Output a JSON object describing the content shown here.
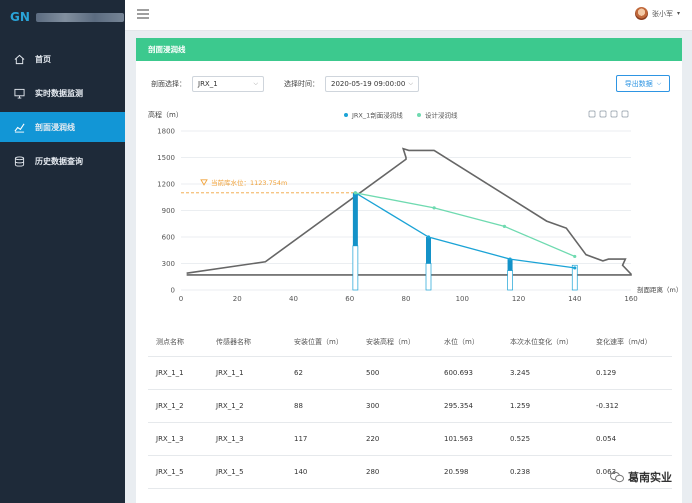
{
  "sidebar": {
    "items": [
      {
        "label": "首页",
        "icon": "home-icon"
      },
      {
        "label": "实时数据监测",
        "icon": "monitor-icon"
      },
      {
        "label": "剖面浸润线",
        "icon": "chart-line-icon",
        "active": true
      },
      {
        "label": "历史数据查询",
        "icon": "database-icon"
      }
    ]
  },
  "topbar": {
    "user_name": "张小军"
  },
  "panel": {
    "title": "剖面浸润线",
    "filters": {
      "section_label": "剖面选择：",
      "section_value": "JRX_1",
      "time_label": "选择时间：",
      "time_value": "2020-05-19 09:00:00"
    },
    "export_label": "导出数据"
  },
  "chart_data": {
    "type": "line",
    "ylabel": "高程（m）",
    "xlabel": "剖面距离（m）",
    "xlim": [
      0,
      160
    ],
    "ylim": [
      0,
      1800
    ],
    "xticks": [
      0,
      20,
      40,
      60,
      80,
      100,
      120,
      140,
      160
    ],
    "yticks": [
      0,
      300,
      600,
      900,
      1200,
      1500,
      1800
    ],
    "legend_position": "top",
    "annotation": "当前库水位：1123.754m",
    "annotation_value": 1100,
    "series": [
      {
        "name": "JRX_1剖面浸润线",
        "color": "#1ba3d6",
        "x": [
          62,
          88,
          117,
          140
        ],
        "y": [
          1100,
          600,
          350,
          250
        ]
      },
      {
        "name": "设计浸润线",
        "color": "#6fdab0",
        "x": [
          62,
          90,
          115,
          140
        ],
        "y": [
          1100,
          930,
          720,
          380
        ]
      }
    ],
    "dam_profile": {
      "x": [
        2,
        30,
        80,
        80,
        79,
        81,
        90,
        130,
        137,
        144,
        150,
        152,
        158,
        157,
        160,
        160,
        2
      ],
      "y": [
        190,
        320,
        1480,
        1500,
        1600,
        1580,
        1580,
        780,
        700,
        400,
        330,
        350,
        350,
        280,
        180,
        170,
        170
      ]
    },
    "sensors": [
      {
        "x": 62,
        "install_height": 500,
        "water_level": 600.693
      },
      {
        "x": 88,
        "install_height": 300,
        "water_level": 295.354
      },
      {
        "x": 117,
        "install_height": 220,
        "water_level": 101.563
      },
      {
        "x": 140,
        "install_height": 280,
        "water_level": 20.598
      }
    ],
    "toolbox_icons": [
      "zoom-icon",
      "zoom-reset-icon",
      "refresh-icon",
      "download-icon"
    ]
  },
  "table": {
    "headers": [
      "测点名称",
      "传感器名称",
      "安装位置（m）",
      "安装高程（m）",
      "水位（m）",
      "本次水位变化（m）",
      "变化速率（m/d）"
    ],
    "rows": [
      [
        "JRX_1_1",
        "JRX_1_1",
        "62",
        "500",
        "600.693",
        "3.245",
        "0.129"
      ],
      [
        "JRX_1_2",
        "JRX_1_2",
        "88",
        "300",
        "295.354",
        "1.259",
        "-0.312"
      ],
      [
        "JRX_1_3",
        "JRX_1_3",
        "117",
        "220",
        "101.563",
        "0.525",
        "0.054"
      ],
      [
        "JRX_1_5",
        "JRX_1_5",
        "140",
        "280",
        "20.598",
        "0.238",
        "0.063"
      ]
    ]
  },
  "watermark": "葛南实业"
}
